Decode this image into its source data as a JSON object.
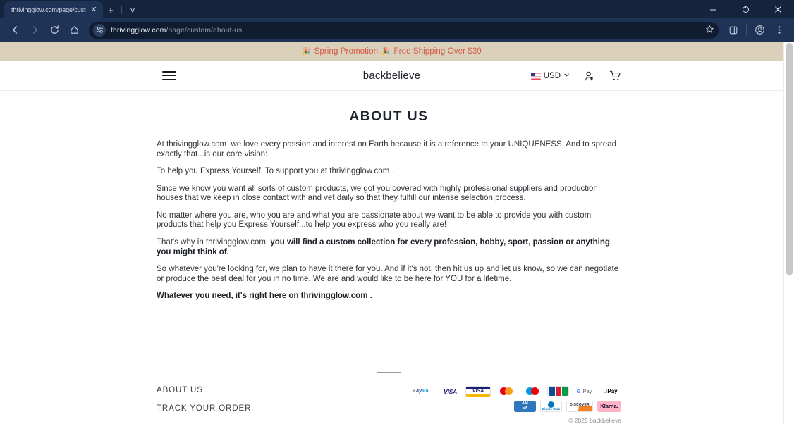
{
  "browser": {
    "tab": {
      "title": "thrivingglow.com/page/custom",
      "close_icon": "close-icon"
    },
    "new_tab_label": "+",
    "tab_list_label": "˅",
    "window_controls": {
      "minimize": "–",
      "maximize": "⬜",
      "close": "✕"
    },
    "nav": {
      "back": "←",
      "forward": "→",
      "reload": "⟳",
      "home": "⌂"
    },
    "omnibox": {
      "site_icon": "site-settings-icon",
      "url_domain": "thrivingglow.com",
      "url_path": "/page/custom/about-us",
      "bookmark_icon": "star-icon"
    },
    "toolbar_right": {
      "split_label": "⧉",
      "profile_label": "◯",
      "menu_label": "⋮"
    }
  },
  "promo": {
    "emoji_left": "🎉",
    "text_left": "Spring Promotion",
    "emoji_right": "🎉",
    "text_right": "Free Shipping Over $39",
    "background": "#dbd0b9",
    "color": "#d4594b"
  },
  "site_header": {
    "menu_icon": "hamburger-menu-icon",
    "brand": "backbelieve",
    "currency": {
      "flag": "us-flag-icon",
      "label": "USD",
      "chevron": "˅"
    },
    "account_icon": "account-icon",
    "cart_icon": "shopping-cart-icon"
  },
  "main": {
    "title": "ABOUT US",
    "paragraphs": [
      {
        "html": "At thrivingglow.com&nbsp; we love every passion and interest on Earth because it is a reference to your UNIQUENESS. And to spread exactly that...is our core vision:",
        "bold": false
      },
      {
        "html": "To help you Express Yourself. To support you at thrivingglow.com .",
        "bold": false
      },
      {
        "html": "Since we know you want all sorts of custom products, we got you covered with highly professional suppliers and production houses that we keep in close contact with and vet daily so that they fulfill our intense selection process.",
        "bold": false
      },
      {
        "html": "No matter where you are, who you are and what you are passionate about we want to be able to provide you with custom products that help you Express Yourself...to help you express who you really are!",
        "bold": false
      },
      {
        "html": "That's why in thrivingglow.com&nbsp; <b>you will find a custom collection for every profession, hobby, sport, passion or anything you might think of.</b>",
        "bold": false
      },
      {
        "html": "So whatever you're looking for, we plan to have it there for you. And if it's not, then hit us up and let us know, so we can negotiate or produce the best deal for you in no time. We are and would like to be here for YOU for a lifetime.",
        "bold": false
      },
      {
        "html": "Whatever you need, it's right here on thrivingglow.com .",
        "bold": true
      }
    ]
  },
  "footer": {
    "links": [
      "ABOUT US",
      "TRACK YOUR ORDER"
    ],
    "payments_row1": [
      "PayPal",
      "VISA",
      "Visa Electron",
      "Mastercard",
      "Maestro",
      "JCB",
      "G Pay",
      "Apple Pay"
    ],
    "payments_row2": [
      "American Express",
      "Diners Club",
      "Discover",
      "Klarna"
    ],
    "copyright": "© 2025 backbelieve"
  },
  "scrollbar": {
    "name": "page-scrollbar"
  }
}
